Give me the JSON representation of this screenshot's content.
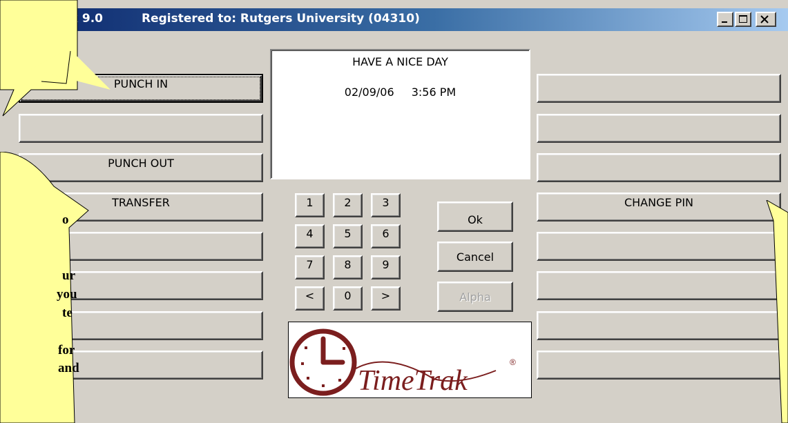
{
  "titlebar": {
    "app_name": "ClocTrak 9.0",
    "registered_to": "Registered to: Rutgers University (04310)"
  },
  "left_buttons": [
    "PUNCH IN",
    "",
    "PUNCH OUT",
    "TRANSFER",
    "",
    "",
    "",
    ""
  ],
  "right_buttons": [
    "",
    "",
    "",
    "CHANGE PIN",
    "",
    "",
    "",
    ""
  ],
  "display": {
    "message": "HAVE A NICE DAY",
    "date": "02/09/06",
    "time": "3:56  PM"
  },
  "keypad": {
    "keys": [
      "1",
      "2",
      "3",
      "4",
      "5",
      "6",
      "7",
      "8",
      "9",
      "<",
      "0",
      ">"
    ]
  },
  "actions": {
    "ok": "Ok",
    "cancel": "Cancel",
    "alpha": "Alpha"
  },
  "logo": {
    "brand": "TimeTrak",
    "registered_mark": "®"
  },
  "callout_left": {
    "lines": [
      "o",
      "",
      "",
      "ur",
      "you",
      "te",
      "",
      "for",
      "and"
    ]
  },
  "colors": {
    "callout_fill": "#ffff99",
    "logo_red": "#7b1e1e",
    "face": "#d4d0c8"
  }
}
